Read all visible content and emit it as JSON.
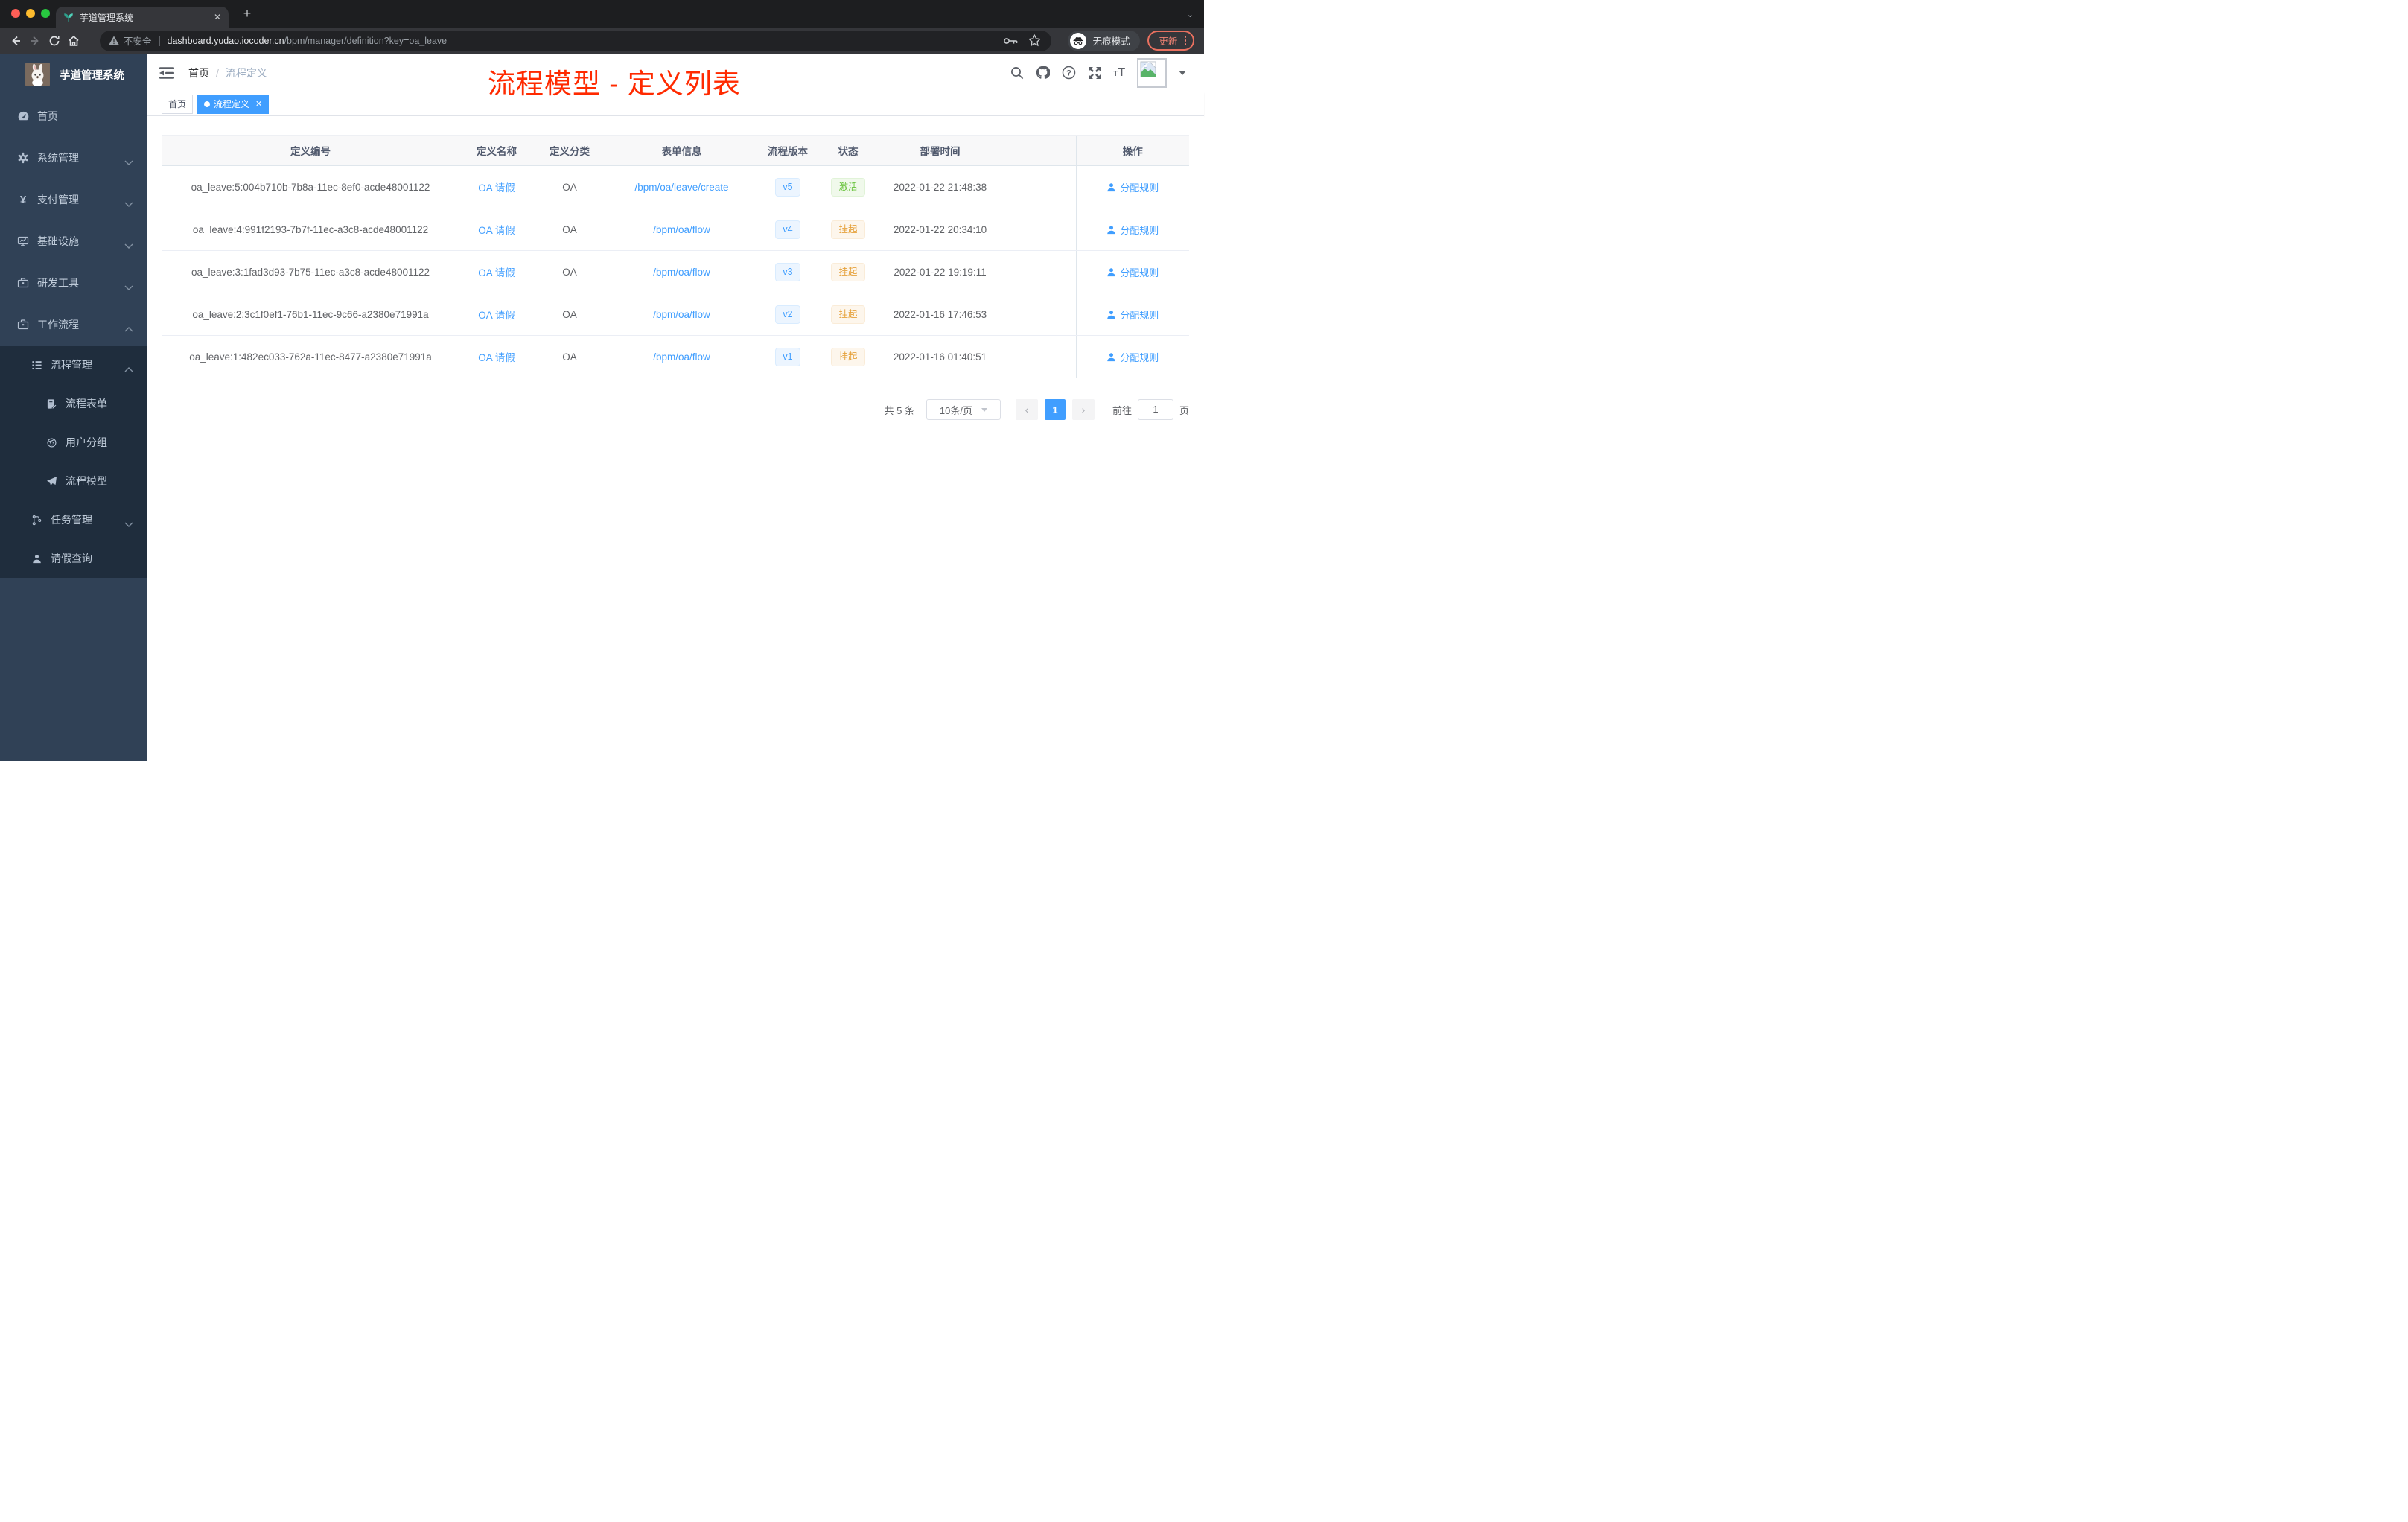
{
  "browser": {
    "tab_title": "芋道管理系统",
    "close_tab": "✕",
    "new_tab": "+",
    "security_label": "不安全",
    "url_host": "dashboard.yudao.iocoder.cn",
    "url_path": "/bpm/manager/definition?key=oa_leave",
    "incognito_label": "无痕模式",
    "update_label": "更新"
  },
  "sidebar": {
    "logo_title": "芋道管理系统",
    "items": [
      {
        "label": "首页",
        "icon": "dashboard-icon"
      },
      {
        "label": "系统管理",
        "icon": "gear-icon",
        "expand": "down"
      },
      {
        "label": "支付管理",
        "icon": "yen-icon",
        "expand": "down"
      },
      {
        "label": "基础设施",
        "icon": "monitor-icon",
        "expand": "down"
      },
      {
        "label": "研发工具",
        "icon": "toolbox-icon",
        "expand": "down"
      },
      {
        "label": "工作流程",
        "icon": "briefcase-icon",
        "expand": "up"
      },
      {
        "label": "流程管理",
        "icon": "tree-list-icon",
        "expand": "up"
      },
      {
        "label": "流程表单",
        "icon": "form-icon"
      },
      {
        "label": "用户分组",
        "icon": "user-group-icon"
      },
      {
        "label": "流程模型",
        "icon": "send-icon"
      },
      {
        "label": "任务管理",
        "icon": "org-icon",
        "expand": "down"
      },
      {
        "label": "请假查询",
        "icon": "person-icon"
      }
    ]
  },
  "header": {
    "breadcrumb_home": "首页",
    "breadcrumb_sep": "/",
    "breadcrumb_current": "流程定义",
    "annotation": "流程模型 - 定义列表",
    "right_icons": [
      "search-icon",
      "github-icon",
      "help-icon",
      "fullscreen-icon",
      "font-size-icon",
      "avatar",
      "caret-down-icon"
    ]
  },
  "tags": {
    "home": "首页",
    "active": "流程定义",
    "close": "✕"
  },
  "table": {
    "columns": [
      "定义编号",
      "定义名称",
      "定义分类",
      "表单信息",
      "流程版本",
      "状态",
      "部署时间",
      "操作"
    ],
    "rows": [
      {
        "id": "oa_leave:5:004b710b-7b8a-11ec-8ef0-acde48001122",
        "name": "OA 请假",
        "category": "OA",
        "form": "/bpm/oa/leave/create",
        "version": "v5",
        "status": "激活",
        "status_type": "success",
        "deploy_time": "2022-01-22 21:48:38",
        "action": "分配规则"
      },
      {
        "id": "oa_leave:4:991f2193-7b7f-11ec-a3c8-acde48001122",
        "name": "OA 请假",
        "category": "OA",
        "form": "/bpm/oa/flow",
        "version": "v4",
        "status": "挂起",
        "status_type": "warning",
        "deploy_time": "2022-01-22 20:34:10",
        "action": "分配规则"
      },
      {
        "id": "oa_leave:3:1fad3d93-7b75-11ec-a3c8-acde48001122",
        "name": "OA 请假",
        "category": "OA",
        "form": "/bpm/oa/flow",
        "version": "v3",
        "status": "挂起",
        "status_type": "warning",
        "deploy_time": "2022-01-22 19:19:11",
        "action": "分配规则"
      },
      {
        "id": "oa_leave:2:3c1f0ef1-76b1-11ec-9c66-a2380e71991a",
        "name": "OA 请假",
        "category": "OA",
        "form": "/bpm/oa/flow",
        "version": "v2",
        "status": "挂起",
        "status_type": "warning",
        "deploy_time": "2022-01-16 17:46:53",
        "action": "分配规则"
      },
      {
        "id": "oa_leave:1:482ec033-762a-11ec-8477-a2380e71991a",
        "name": "OA 请假",
        "category": "OA",
        "form": "/bpm/oa/flow",
        "version": "v1",
        "status": "挂起",
        "status_type": "warning",
        "deploy_time": "2022-01-16 01:40:51",
        "action": "分配规则"
      }
    ]
  },
  "pagination": {
    "total": "共 5 条",
    "page_size": "10条/页",
    "prev": "‹",
    "page": "1",
    "next": "›",
    "goto": "前往",
    "goto_value": "1",
    "unit": "页"
  },
  "colors": {
    "accent": "#409eff",
    "success": "#67c23a",
    "warning": "#e6a23c",
    "annotation_red": "#ff2a00",
    "sidebar_bg": "#304156",
    "submenu_bg": "#1f2d3d",
    "update_pill": "#e8705f"
  }
}
